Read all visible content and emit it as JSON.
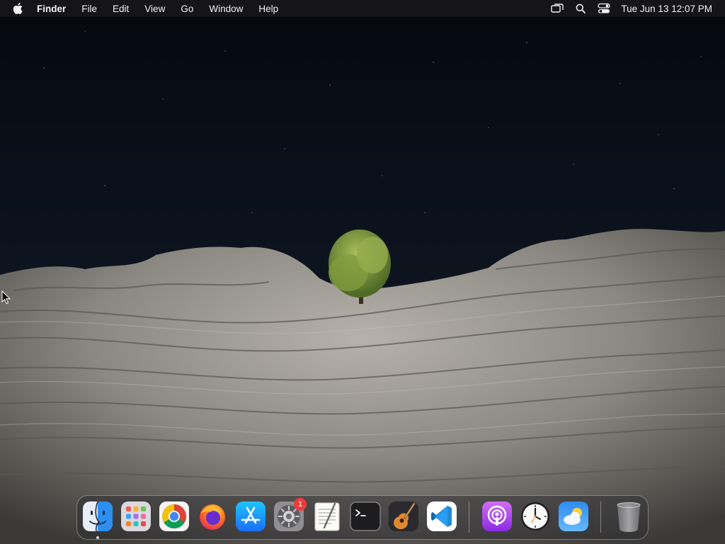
{
  "menubar": {
    "app_name": "Finder",
    "menus": [
      "File",
      "Edit",
      "View",
      "Go",
      "Window",
      "Help"
    ],
    "clock": "Tue Jun 13  12:07 PM",
    "status_icons": [
      "screen-mirroring-icon",
      "spotlight-search-icon",
      "control-center-icon"
    ]
  },
  "dock": {
    "apps": [
      {
        "id": "finder",
        "icon": "finder-icon",
        "running": true
      },
      {
        "id": "launchpad",
        "icon": "launchpad-icon"
      },
      {
        "id": "chrome",
        "icon": "chrome-icon"
      },
      {
        "id": "firefox",
        "icon": "firefox-icon"
      },
      {
        "id": "app-store",
        "icon": "app-store-icon"
      },
      {
        "id": "system-settings",
        "icon": "system-settings-icon",
        "badge": "1"
      },
      {
        "id": "textedit",
        "icon": "textedit-icon"
      },
      {
        "id": "terminal",
        "icon": "terminal-icon"
      },
      {
        "id": "garageband",
        "icon": "garageband-icon"
      },
      {
        "id": "vscode",
        "icon": "vscode-icon"
      },
      {
        "id": "podcasts",
        "icon": "podcasts-icon"
      },
      {
        "id": "clock",
        "icon": "clock-icon"
      },
      {
        "id": "weather",
        "icon": "weather-icon"
      },
      {
        "id": "trash",
        "icon": "trash-icon"
      }
    ]
  },
  "colors": {
    "sky": "#0b1018",
    "rock": "#8f8c86",
    "tree": "#7d9a3c",
    "badge": "#ef3b3b",
    "menubar": "#16161a"
  }
}
